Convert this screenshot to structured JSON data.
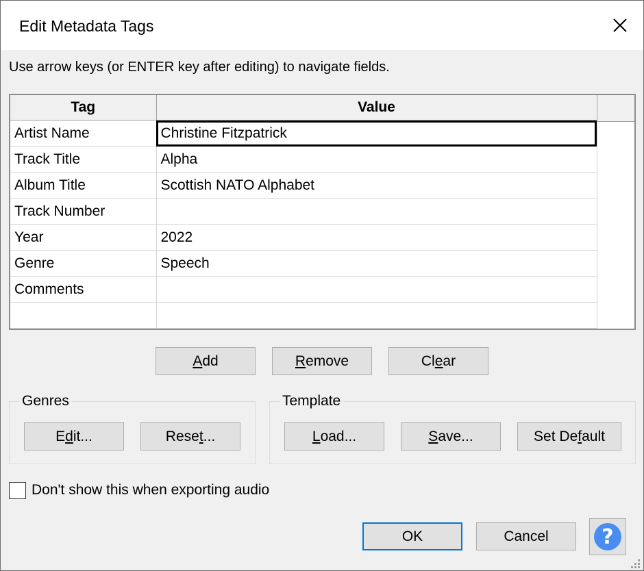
{
  "window": {
    "title": "Edit Metadata Tags",
    "close_glyph": "✕"
  },
  "instructions": "Use arrow keys (or ENTER key after editing) to navigate fields.",
  "grid": {
    "headers": {
      "tag": "Tag",
      "value": "Value"
    },
    "rows": [
      {
        "tag": "Artist Name",
        "value": "Christine Fitzpatrick"
      },
      {
        "tag": "Track Title",
        "value": "Alpha"
      },
      {
        "tag": "Album Title",
        "value": "Scottish NATO Alphabet"
      },
      {
        "tag": "Track Number",
        "value": ""
      },
      {
        "tag": "Year",
        "value": "2022"
      },
      {
        "tag": "Genre",
        "value": "Speech"
      },
      {
        "tag": "Comments",
        "value": ""
      },
      {
        "tag": "",
        "value": ""
      }
    ]
  },
  "tag_buttons": {
    "add": {
      "pre": "",
      "u": "A",
      "post": "dd"
    },
    "remove": {
      "pre": "",
      "u": "R",
      "post": "emove"
    },
    "clear": {
      "pre": "Cl",
      "u": "e",
      "post": "ar"
    }
  },
  "genres": {
    "label": "Genres",
    "edit": {
      "pre": "E",
      "u": "d",
      "post": "it..."
    },
    "reset": {
      "pre": "Rese",
      "u": "t",
      "post": "..."
    }
  },
  "template": {
    "label": "Template",
    "load": {
      "pre": "",
      "u": "L",
      "post": "oad..."
    },
    "save": {
      "pre": "",
      "u": "S",
      "post": "ave..."
    },
    "set_default": {
      "pre": "Set De",
      "u": "f",
      "post": "ault"
    }
  },
  "dont_show": {
    "label": "Don't show this when exporting audio",
    "checked": false
  },
  "footer": {
    "ok": "OK",
    "cancel": "Cancel",
    "help_glyph": "?"
  },
  "colors": {
    "accent": "#0078d7",
    "help": "#4a8df0"
  }
}
